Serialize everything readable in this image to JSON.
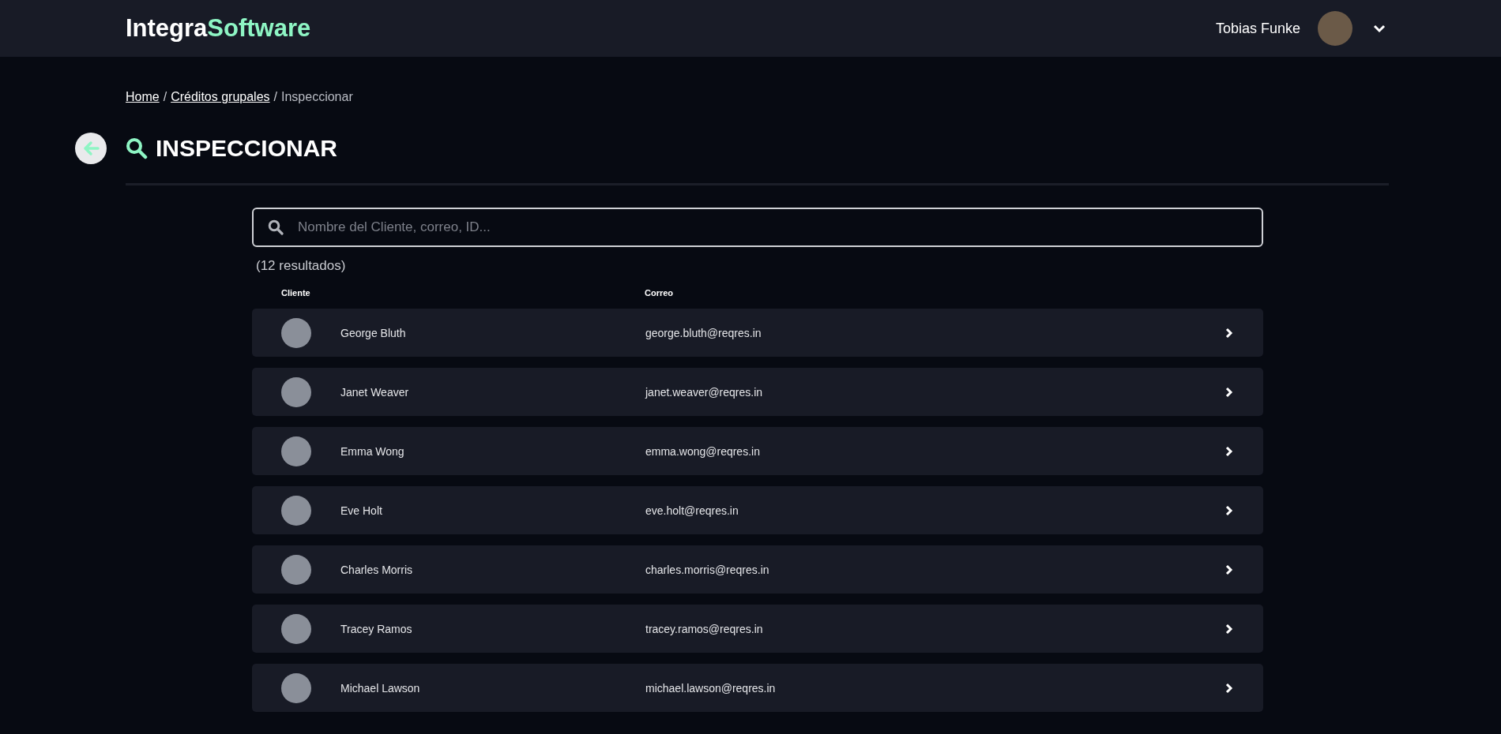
{
  "header": {
    "logo": {
      "part_1": "Integra",
      "part_2": "Software"
    },
    "user_name": "Tobias Funke"
  },
  "breadcrumb": [
    {
      "label": "Home",
      "link": true
    },
    {
      "label": "Créditos grupales",
      "link": true
    },
    {
      "label": "Inspeccionar",
      "link": false
    }
  ],
  "breadcrumb_separator": "/",
  "title": "INSPECCIONAR",
  "search": {
    "placeholder": "Nombre del Cliente, correo, ID..."
  },
  "result_count": "(12 resultados)",
  "table": {
    "columns": [
      "Cliente",
      "Correo"
    ],
    "rows": [
      {
        "name": "George Bluth",
        "email": "george.bluth@reqres.in"
      },
      {
        "name": "Janet Weaver",
        "email": "janet.weaver@reqres.in"
      },
      {
        "name": "Emma Wong",
        "email": "emma.wong@reqres.in"
      },
      {
        "name": "Eve Holt",
        "email": "eve.holt@reqres.in"
      },
      {
        "name": "Charles Morris",
        "email": "charles.morris@reqres.in"
      },
      {
        "name": "Tracey Ramos",
        "email": "tracey.ramos@reqres.in"
      },
      {
        "name": "Michael Lawson",
        "email": "michael.lawson@reqres.in"
      }
    ]
  }
}
